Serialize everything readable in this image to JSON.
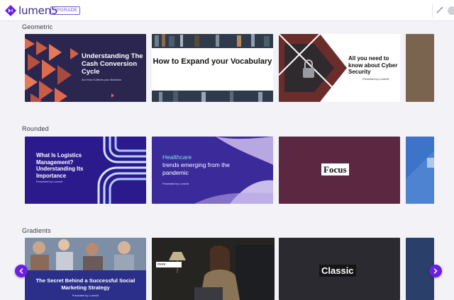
{
  "header": {
    "brand": "lumen5",
    "upgrade_label": "UPGRADE",
    "brand_color": "#6a1fe3"
  },
  "sections": [
    {
      "title": "Geometric",
      "cards": [
        {
          "title": "Understanding The Cash Conversion Cycle",
          "subtitle": "And How It Affects your Business"
        },
        {
          "title": "How to Expand your Vocabulary"
        },
        {
          "title": "All you need to know about Cyber Security",
          "subtitle": "Presented by Lumen5"
        }
      ]
    },
    {
      "title": "Rounded",
      "cards": [
        {
          "title": "What Is Logistics Management? Understanding Its Importance",
          "subtitle": "Presented by Lumen5"
        },
        {
          "kicker": "Healthcare",
          "title": "trends emerging from the pandemic",
          "subtitle": "Presented by Lumen5"
        },
        {
          "title": "Focus"
        }
      ]
    },
    {
      "title": "Gradients",
      "cards": [
        {
          "title": "The Secret Behind a Successful Social Marketing Strategy",
          "subtitle": "Presented by Lumen5"
        },
        {
          "caption": "more"
        },
        {
          "title": "Classic"
        }
      ]
    }
  ]
}
